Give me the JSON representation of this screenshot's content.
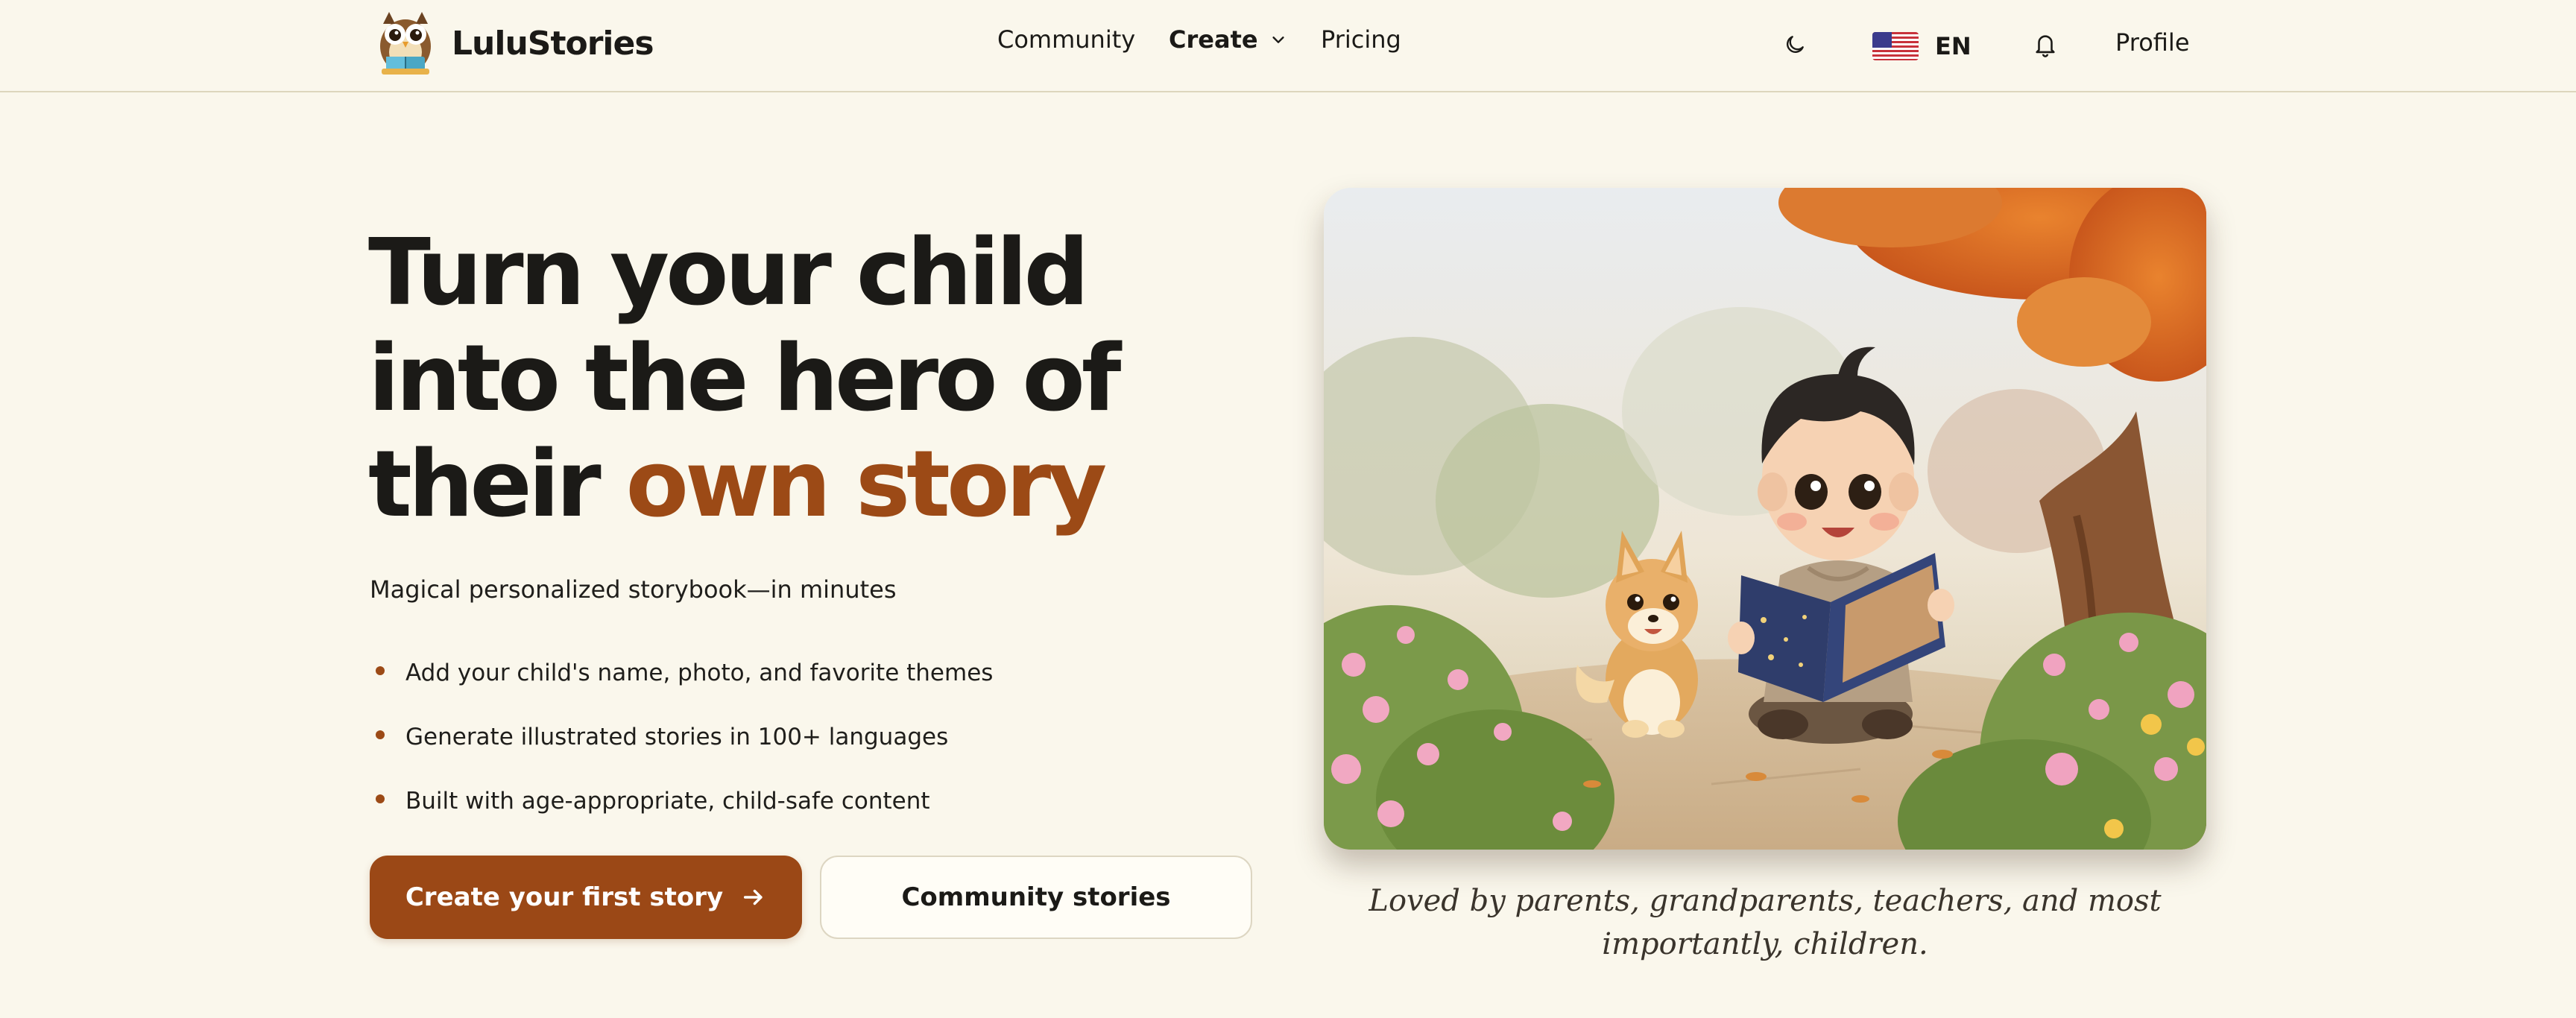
{
  "brand": {
    "name": "LuluStories",
    "logo_icon": "owl-reading-icon"
  },
  "nav": {
    "links": [
      {
        "label": "Community"
      },
      {
        "label": "Create",
        "has_dropdown": true
      },
      {
        "label": "Pricing"
      }
    ],
    "theme_icon": "moon-icon",
    "language": {
      "code": "EN",
      "flag_icon": "us-flag-icon"
    },
    "notifications_icon": "bell-icon",
    "profile_label": "Profile"
  },
  "hero": {
    "headline_line1": "Turn your child",
    "headline_line2": "into the hero of",
    "headline_line3_prefix": "their ",
    "headline_accent": "own story",
    "subtitle": "Magical personalized storybook—in minutes",
    "bullets": [
      "Add your child's name, photo, and favorite themes",
      "Generate illustrated stories in 100+ languages",
      "Built with age-appropriate, child-safe content"
    ],
    "primary_cta": "Create your first story",
    "secondary_cta": "Community stories",
    "tagline": "Loved by parents, grandparents, teachers, and most importantly, children."
  },
  "colors": {
    "background": "#faf7ec",
    "accent": "#9c4a16",
    "text": "#1b1a17"
  }
}
